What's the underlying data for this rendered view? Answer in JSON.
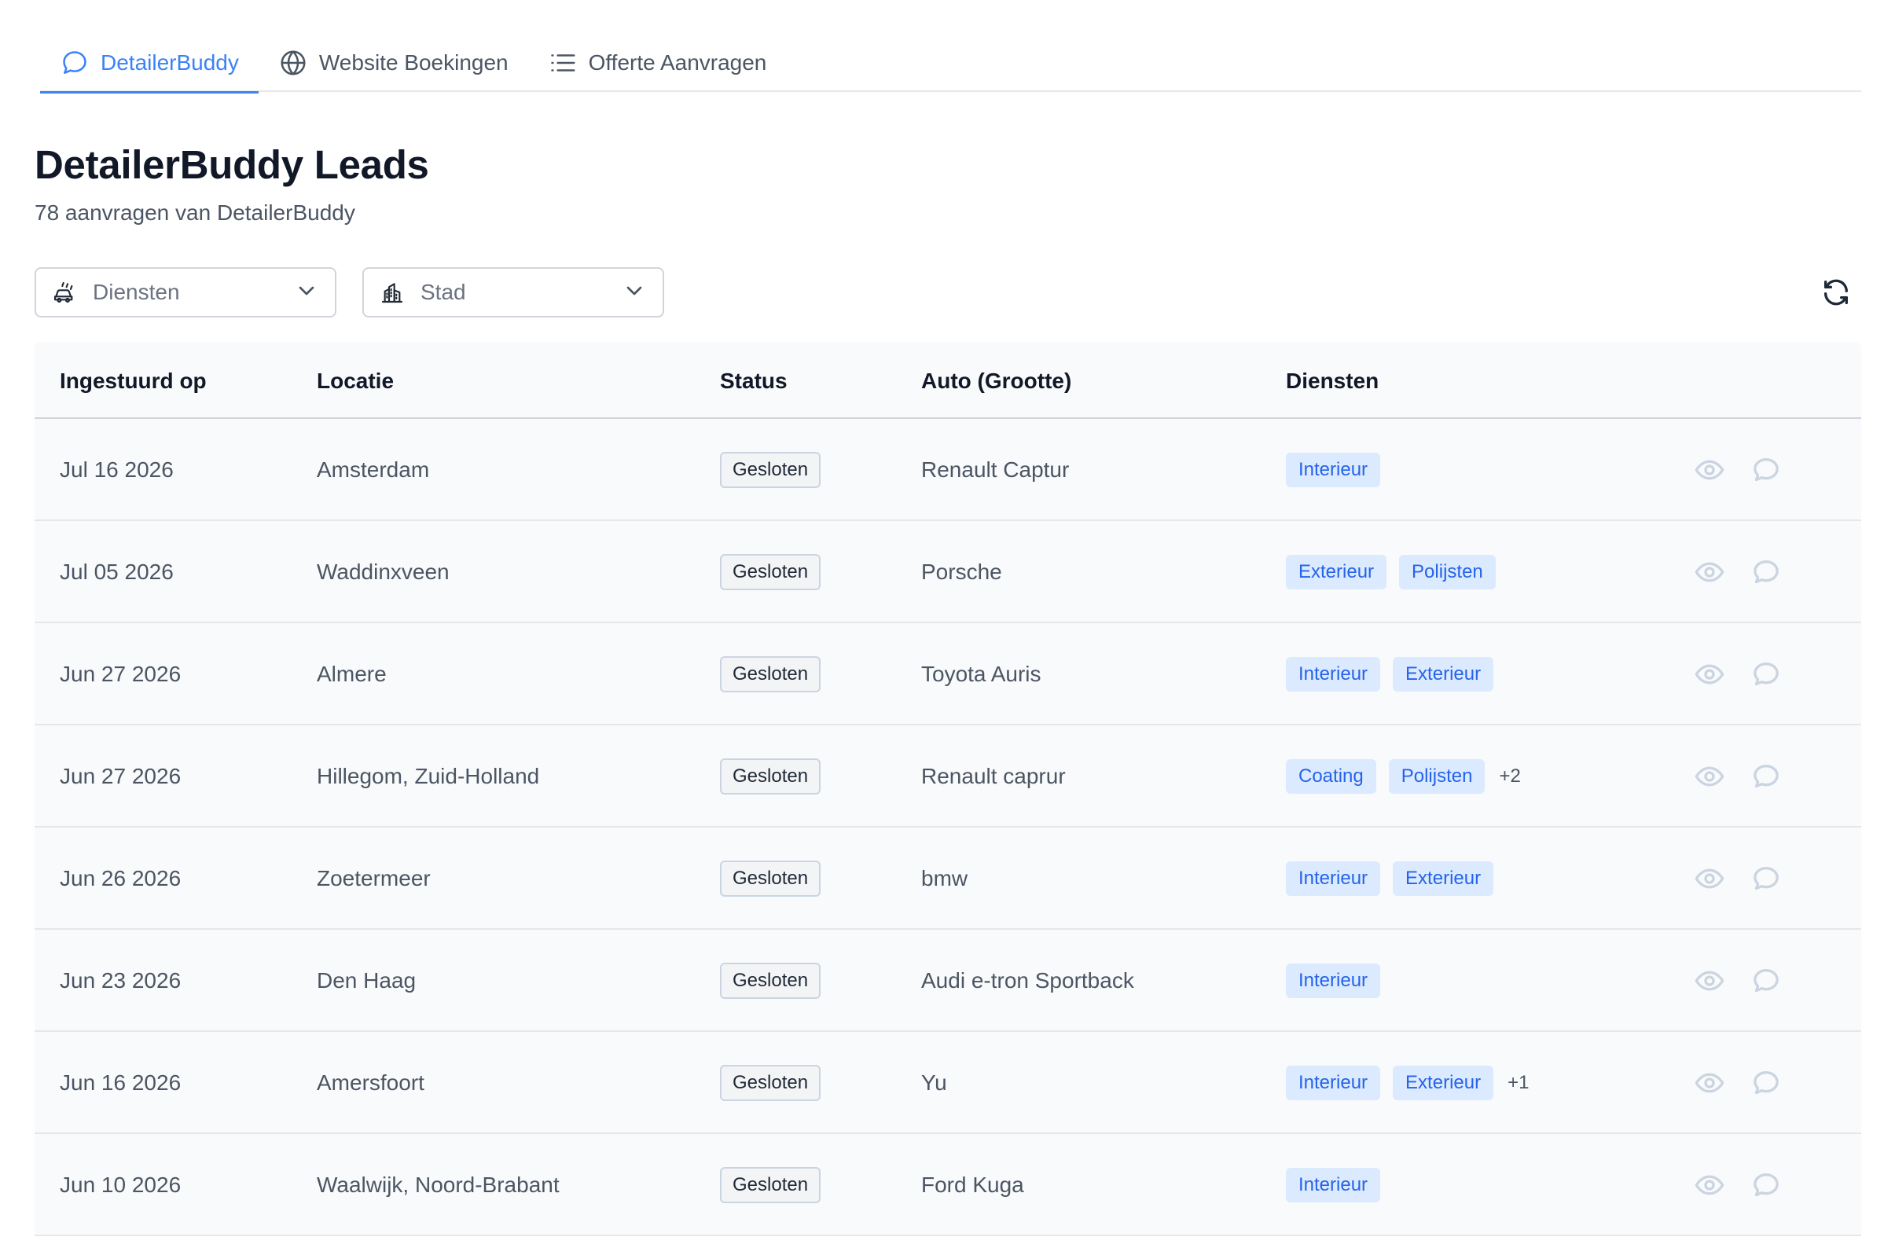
{
  "tabs": [
    {
      "label": "DetailerBuddy",
      "icon": "chat-bubble-icon",
      "active": true
    },
    {
      "label": "Website Boekingen",
      "icon": "globe-icon",
      "active": false
    },
    {
      "label": "Offerte Aanvragen",
      "icon": "list-icon",
      "active": false
    }
  ],
  "header": {
    "title": "DetailerBuddy Leads",
    "subtitle": "78 aanvragen van DetailerBuddy"
  },
  "filters": {
    "diensten": {
      "placeholder": "Diensten",
      "icon": "car-wash-icon"
    },
    "stad": {
      "placeholder": "Stad",
      "icon": "city-buildings-icon"
    }
  },
  "refresh_icon": "refresh-icon",
  "table": {
    "headers": [
      "Ingestuurd op",
      "Locatie",
      "Status",
      "Auto (Grootte)",
      "Diensten"
    ],
    "rows": [
      {
        "date": "Jul 16 2026",
        "location": "Amsterdam",
        "status": "Gesloten",
        "car": "Renault Captur",
        "services": [
          "Interieur"
        ],
        "more": ""
      },
      {
        "date": "Jul 05 2026",
        "location": "Waddinxveen",
        "status": "Gesloten",
        "car": "Porsche",
        "services": [
          "Exterieur",
          "Polijsten"
        ],
        "more": ""
      },
      {
        "date": "Jun 27 2026",
        "location": "Almere",
        "status": "Gesloten",
        "car": "Toyota Auris",
        "services": [
          "Interieur",
          "Exterieur"
        ],
        "more": ""
      },
      {
        "date": "Jun 27 2026",
        "location": "Hillegom, Zuid-Holland",
        "status": "Gesloten",
        "car": "Renault caprur",
        "services": [
          "Coating",
          "Polijsten"
        ],
        "more": "+2"
      },
      {
        "date": "Jun 26 2026",
        "location": "Zoetermeer",
        "status": "Gesloten",
        "car": "bmw",
        "services": [
          "Interieur",
          "Exterieur"
        ],
        "more": ""
      },
      {
        "date": "Jun 23 2026",
        "location": "Den Haag",
        "status": "Gesloten",
        "car": "Audi e-tron Sportback",
        "services": [
          "Interieur"
        ],
        "more": ""
      },
      {
        "date": "Jun 16 2026",
        "location": "Amersfoort",
        "status": "Gesloten",
        "car": "Yu",
        "services": [
          "Interieur",
          "Exterieur"
        ],
        "more": "+1"
      },
      {
        "date": "Jun 10 2026",
        "location": "Waalwijk, Noord-Brabant",
        "status": "Gesloten",
        "car": "Ford Kuga",
        "services": [
          "Interieur"
        ],
        "more": ""
      }
    ]
  },
  "colors": {
    "accent": "#3b82f6",
    "tag_bg": "#dbeafe",
    "tag_text": "#2563eb",
    "row_bg": "#f9fafb"
  }
}
